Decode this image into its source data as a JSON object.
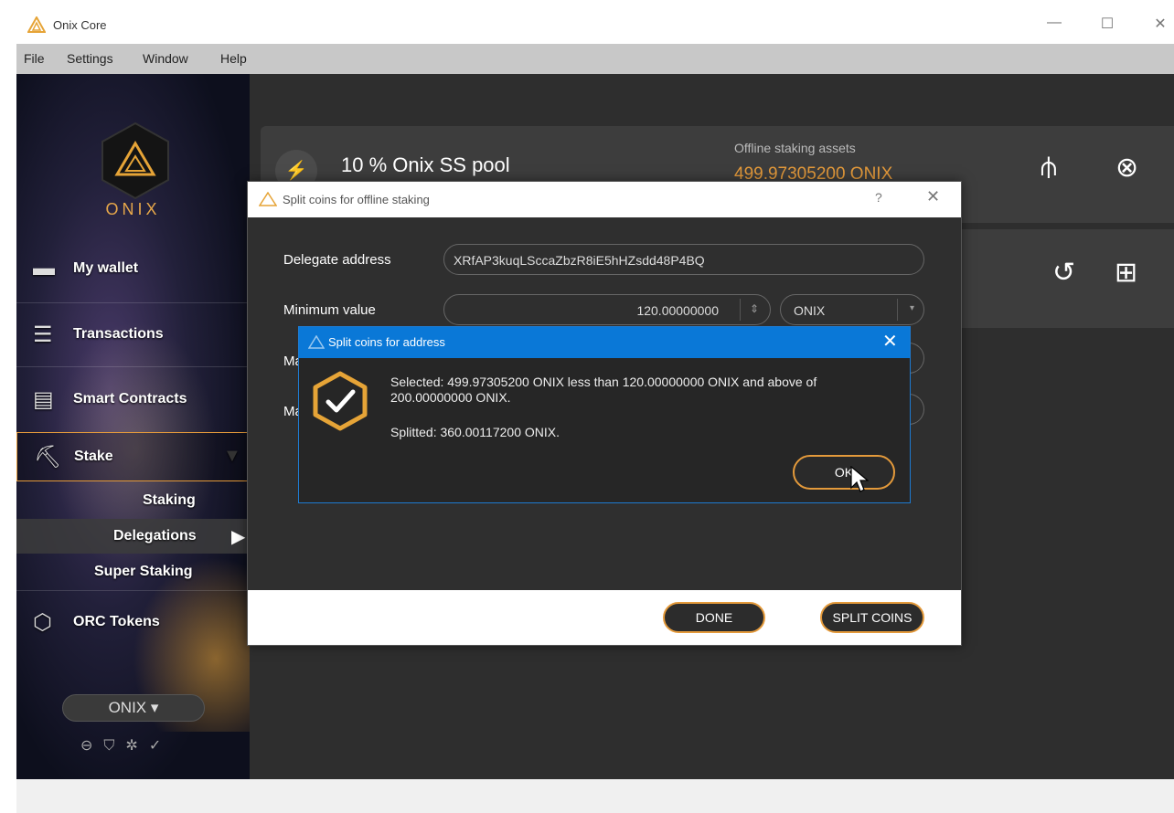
{
  "window": {
    "title": "Onix Core",
    "controls": {
      "minimize": "—",
      "maximize": "☐",
      "close": "✕"
    }
  },
  "menu": [
    "File",
    "Settings",
    "Window",
    "Help"
  ],
  "brand": {
    "name": "ONIX"
  },
  "sidebar": {
    "items": [
      {
        "label": "My wallet",
        "icon": "wallet-icon"
      },
      {
        "label": "Transactions",
        "icon": "transactions-icon"
      },
      {
        "label": "Smart Contracts",
        "icon": "smart-contracts-icon"
      },
      {
        "label": "Stake",
        "icon": "pickaxe-icon"
      },
      {
        "label": "ORC Tokens",
        "icon": "orc-tokens-icon"
      }
    ],
    "stake_sub": [
      "Staking",
      "Delegations",
      "Super Staking"
    ],
    "coin_selector": "ONIX ▾"
  },
  "pool_card": {
    "title": "10 % Onix SS pool",
    "assets_label": "Offline staking assets",
    "assets_value": "499.97305200 ONIX"
  },
  "split_dialog": {
    "title": "Split coins for offline staking",
    "help": "?",
    "close": "✕",
    "delegate_label": "Delegate address",
    "delegate_value": "XRfAP3kuqLSccaZbzR8iE5hHZsdd48P4BQ",
    "min_label": "Minimum value",
    "min_value": "120.00000000",
    "min_unit": "ONIX",
    "max_label_partial": "Ma",
    "max2_label_partial": "Ma",
    "done_label": "DONE",
    "split_label": "SPLIT COINS"
  },
  "address_dialog": {
    "title": "Split coins for address",
    "close": "✕",
    "line1": "Selected: 499.97305200 ONIX less than 120.00000000 ONIX and above of",
    "line2": "200.00000000 ONIX.",
    "line3": "Splitted: 360.00117200 ONIX.",
    "ok_label": "OK"
  },
  "colors": {
    "accent": "#e49a3b",
    "dialog_blue": "#0a78d7"
  }
}
